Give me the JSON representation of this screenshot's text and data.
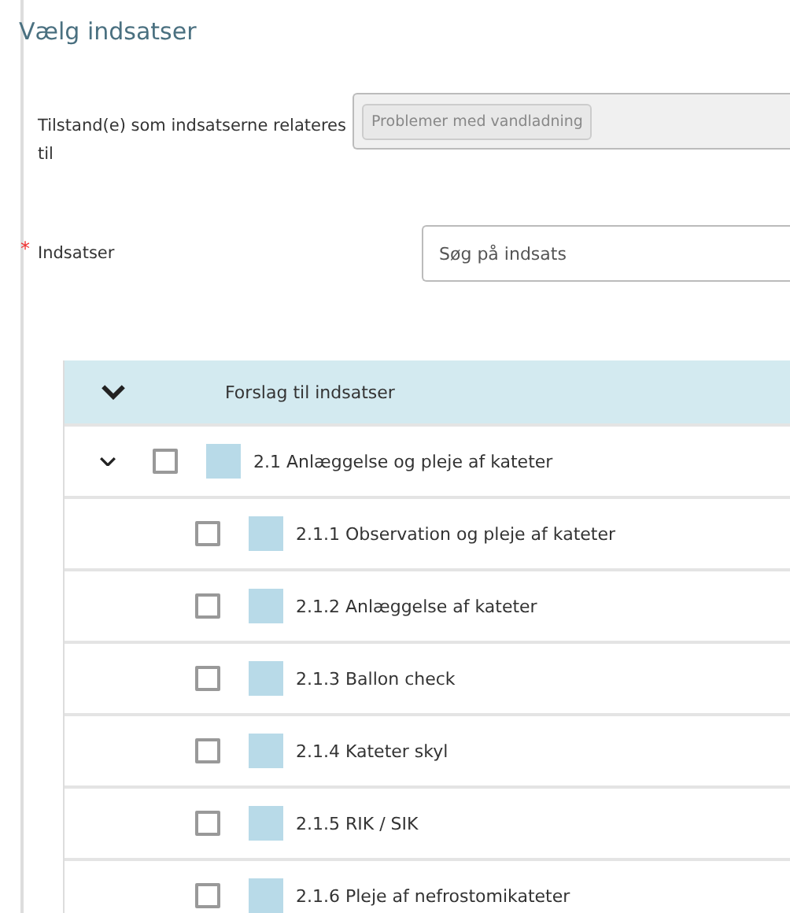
{
  "title": "Vælg indsatser",
  "condition_field": {
    "label": "Tilstand(e) som indsatserne relateres til",
    "tags": [
      "Problemer med vandladning"
    ],
    "disabled": true
  },
  "interventions_field": {
    "label": "Indsatser",
    "required_marker": "*",
    "placeholder": "Søg på indsats"
  },
  "suggestions": {
    "header": "Forslag til indsatser",
    "expanded": true,
    "items": [
      {
        "label": "2.1 Anlæggelse og pleje af kateter",
        "checked": false,
        "expanded": true,
        "children": [
          {
            "label": "2.1.1 Observation og pleje af kateter",
            "checked": false
          },
          {
            "label": "2.1.2 Anlæggelse af kateter",
            "checked": false
          },
          {
            "label": "2.1.3 Ballon check",
            "checked": false
          },
          {
            "label": "2.1.4 Kateter skyl",
            "checked": false
          },
          {
            "label": "2.1.5 RIK / SIK",
            "checked": false
          },
          {
            "label": "2.1.6 Pleje af nefrostomikateter",
            "checked": false
          }
        ]
      }
    ]
  }
}
